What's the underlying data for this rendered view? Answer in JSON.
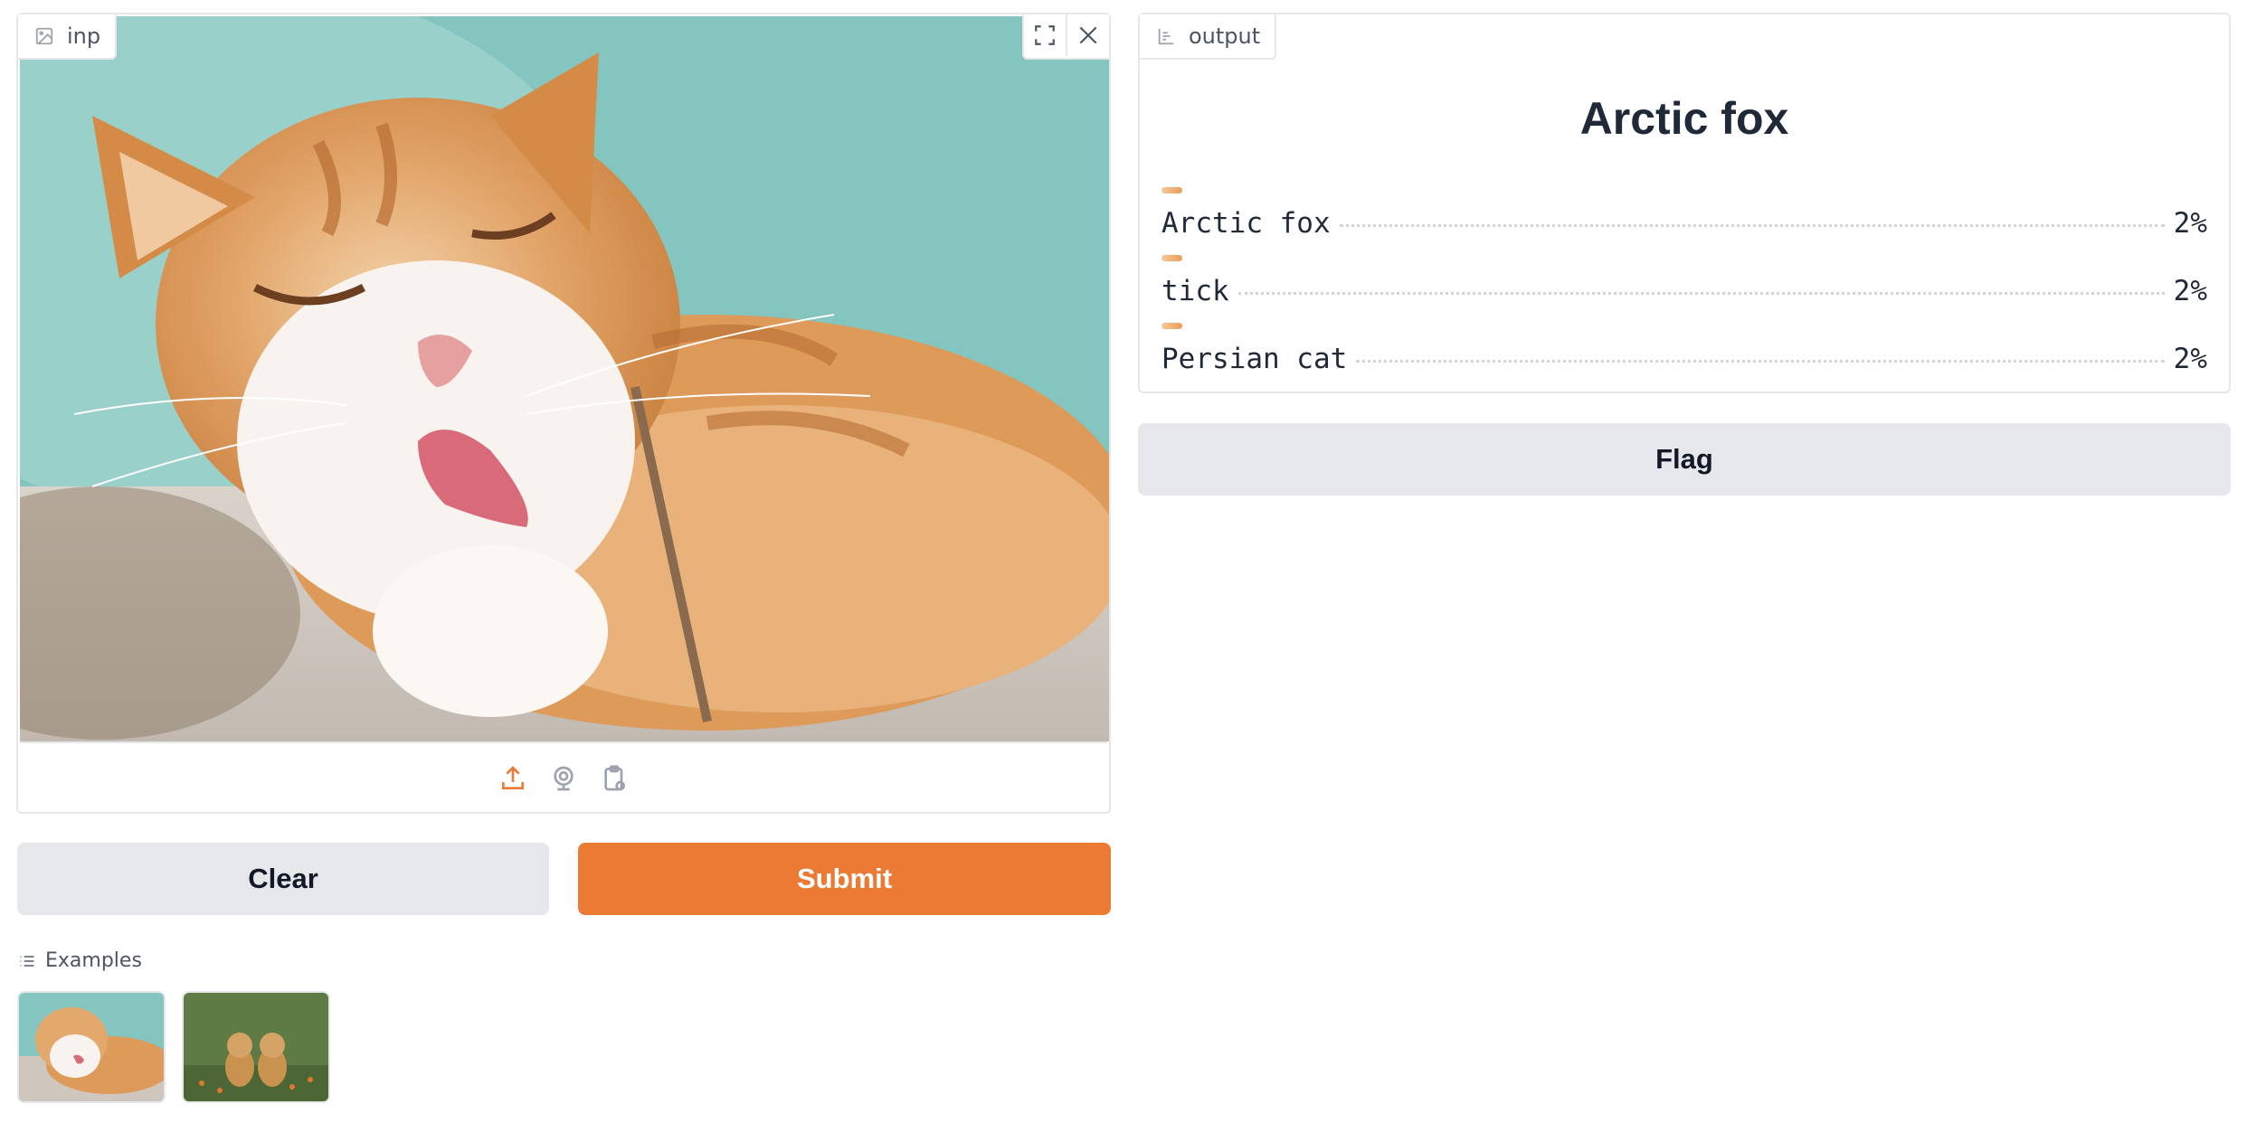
{
  "input": {
    "label": "inp",
    "icon": "image-icon",
    "controls": [
      "fullscreen-icon",
      "close-icon"
    ],
    "sources": [
      "upload-icon",
      "webcam-icon",
      "clipboard-icon"
    ]
  },
  "buttons": {
    "clear": "Clear",
    "submit": "Submit",
    "flag": "Flag"
  },
  "examples": {
    "label": "Examples",
    "items": [
      "cat-example-thumbnail",
      "puppies-example-thumbnail"
    ]
  },
  "output": {
    "label": "output",
    "icon": "bar-chart-icon",
    "predicted": "Arctic fox",
    "confidences": [
      {
        "label": "Arctic fox",
        "value": "2%",
        "fraction": 0.02
      },
      {
        "label": "tick",
        "value": "2%",
        "fraction": 0.02
      },
      {
        "label": "Persian cat",
        "value": "2%",
        "fraction": 0.02
      }
    ]
  },
  "colors": {
    "accent": "#eb7b34",
    "secondary_button": "#e5e7eb",
    "border": "#e5e7eb"
  }
}
